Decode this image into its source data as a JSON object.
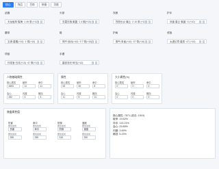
{
  "tabs": [
    {
      "label": "核心",
      "active": true
    },
    {
      "label": "饰品",
      "active": false
    },
    {
      "label": "百炼",
      "active": false
    },
    {
      "label": "装备",
      "active": false
    },
    {
      "label": "功能",
      "active": false
    }
  ],
  "slots": [
    {
      "label": "武器",
      "item": "天龙破风·裂海 ·1 49 带 (+10)"
    },
    {
      "label": "头部",
      "item": "玄霜无相·紫翼 ·1 4 帽(+10)"
    },
    {
      "label": "衣服",
      "item": "烈阳长炎·裳云 ·2 10 带 (+10)"
    },
    {
      "label": "护手",
      "item": "凤凰·星云·紫晶 ·3 (+10)"
    },
    {
      "label": "腰带",
      "item": "玉清·星耀(+10) ·1 带(+10)"
    },
    {
      "label": "鞋",
      "item": "风吟·追月(+10) ·3 7 带(+10)"
    },
    {
      "label": "护肩",
      "item": "御气·朱雀(+10) ·47 带(+10)"
    },
    {
      "label": "戒指",
      "item": "太虚幻境·星辰 ·47 (+10)"
    },
    {
      "label": "项链",
      "item": "玲珑宝·日月(+10) ·47 带(+10)"
    },
    {
      "label": "手镯",
      "item": "碧波流光·碎玉(+10)"
    }
  ],
  "panel_a": {
    "title": "人物基础属性",
    "fields": [
      {
        "k": "核心属性",
        "v": "2693"
      },
      {
        "k": "破甲",
        "v": "11"
      },
      {
        "k": "命中",
        "v": "11"
      },
      {
        "k": "会心",
        "v": "252"
      },
      {
        "k": "闪避",
        "v": "3"
      },
      {
        "k": "格挡",
        "v": "3"
      }
    ]
  },
  "panel_b": {
    "title": "属性",
    "fields": [
      {
        "k": "核心属性",
        "v": "53"
      },
      {
        "k": "破甲",
        "v": "40"
      },
      {
        "k": "命中",
        "v": "8"
      },
      {
        "k": "会心",
        "v": "11"
      },
      {
        "k": "闪避",
        "v": "5"
      },
      {
        "k": "格挡",
        "v": "11"
      }
    ]
  },
  "panel_c": {
    "title": "大小属性(%)",
    "fields": [
      {
        "k": "核心属性",
        "v": "0"
      },
      {
        "k": "破甲",
        "v": "0"
      },
      {
        "k": "命中",
        "v": "0"
      },
      {
        "k": "会心",
        "v": "0"
      },
      {
        "k": "闪避",
        "v": "0"
      },
      {
        "k": "格挡",
        "v": "0"
      }
    ]
  },
  "panel_d": {
    "title": "装备属性值",
    "columns": [
      {
        "h": "伤害",
        "sub1": "属性加成",
        "v1": "伤害",
        "sub2": "属性加成",
        "v2": "255"
      },
      {
        "h": "命中",
        "sub1": "属性加成",
        "v1": "命中",
        "sub2": "属性加成",
        "v2": "295"
      },
      {
        "h": "防御",
        "sub1": "属性加成",
        "v1": "防御",
        "sub2": "属性加成",
        "v2": "315"
      },
      {
        "h": "速度",
        "sub1": "属性加成",
        "v1": "速度",
        "sub2": "属性加成",
        "v2": "290"
      }
    ]
  },
  "stats": [
    "核心属性: 7571 (攻击: 1510)",
    "破甲: 19.52%",
    "命中: 113.21%",
    "会心: 29.85%",
    "闪避: 3.69%",
    "格挡: 5.23%"
  ]
}
